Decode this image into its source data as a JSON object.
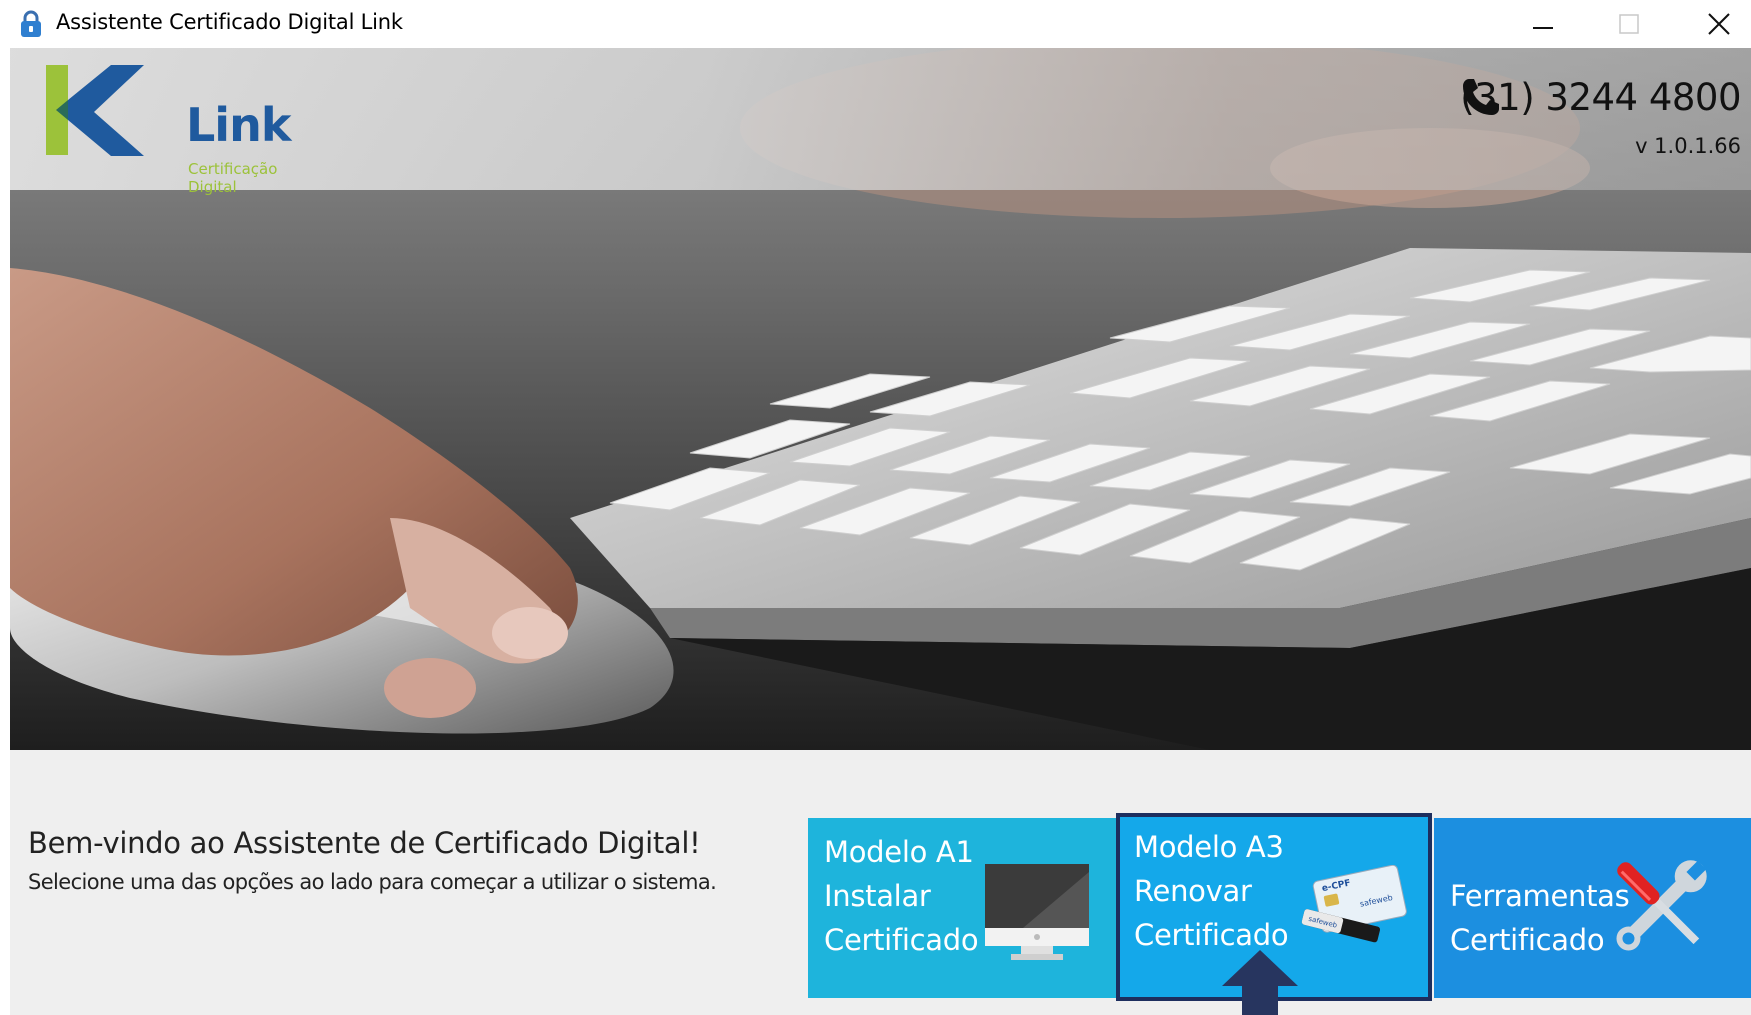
{
  "window": {
    "title": "Assistente Certificado Digital Link",
    "controls": {
      "minimize": "minimize",
      "maximize": "maximize",
      "close": "close"
    }
  },
  "header": {
    "logo_word": "Link",
    "logo_tagline": "Certificação Digital",
    "phone": "(31) 3244 4800",
    "version": "v 1.0.1.66"
  },
  "welcome": {
    "title": "Bem-vindo ao Assistente de Certificado Digital!",
    "subtitle": "Selecione uma das opções ao lado para começar a utilizar o sistema."
  },
  "tiles": [
    {
      "lines": [
        "Modelo A1",
        "Instalar",
        "Certificado"
      ],
      "icon": "monitor-icon",
      "color": "#1eb4dc"
    },
    {
      "lines": [
        "Modelo A3",
        "Renovar",
        "Certificado"
      ],
      "icon": "smartcard-token-icon",
      "color": "#14a8ea",
      "selected": true
    },
    {
      "lines": [
        "Ferramentas",
        "Certificado"
      ],
      "icon": "tools-icon",
      "color": "#1c8fe0"
    }
  ],
  "colors": {
    "logo_blue": "#1f5a9e",
    "logo_green": "#9cc23a",
    "selection_border": "#1d2e5e",
    "arrow": "#27355f"
  }
}
